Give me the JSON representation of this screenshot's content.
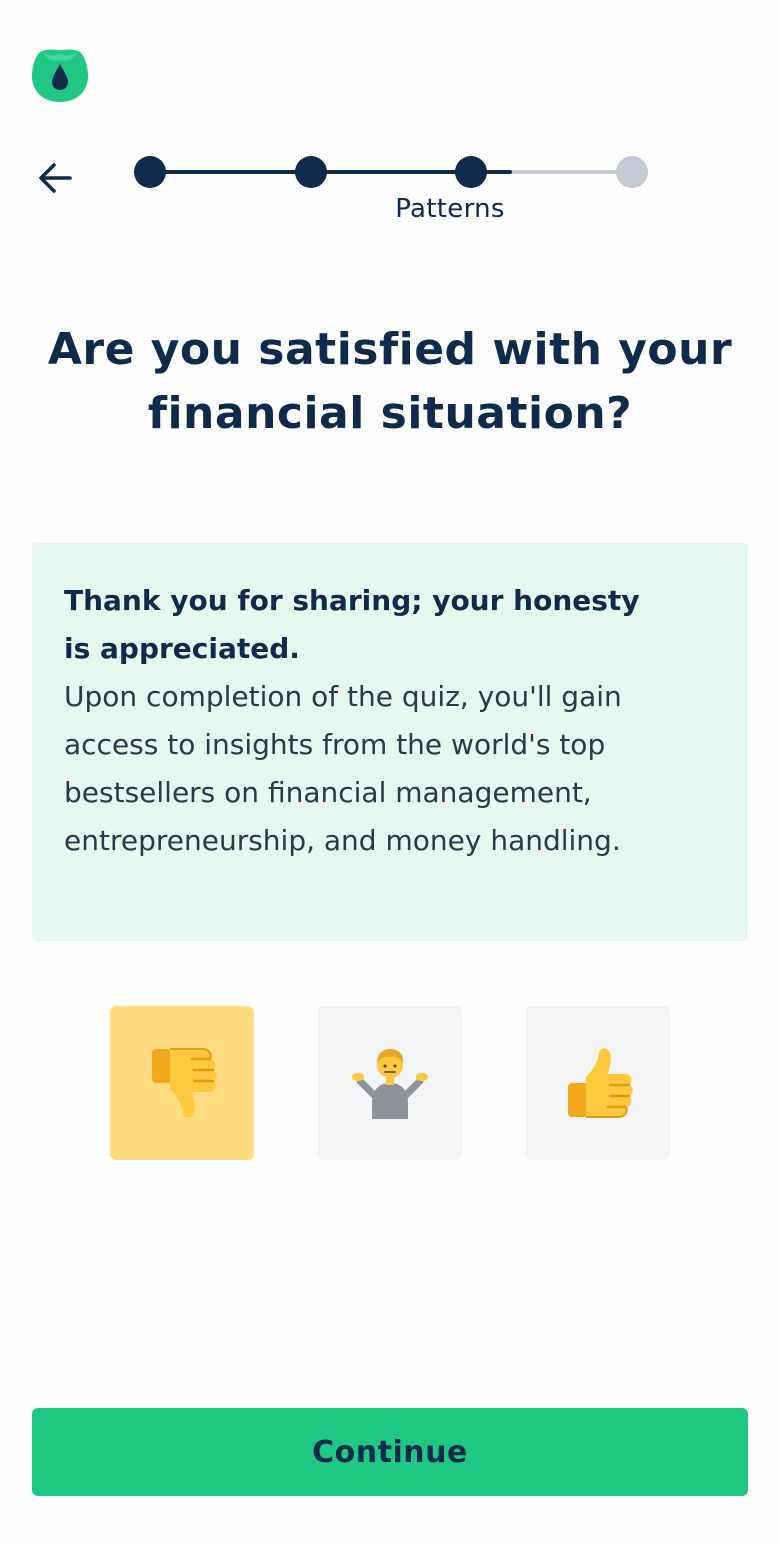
{
  "app": {
    "logo_icon": "droplet-leaf-logo-icon",
    "brand_color": "#1fc882"
  },
  "header": {
    "back_icon": "arrow-left-icon"
  },
  "progress": {
    "step_label": "Patterns",
    "total_steps": 4,
    "completed_steps": 3,
    "fill_fraction": 0.75,
    "active_color": "#0f2a4a",
    "inactive_color": "#c3cad3"
  },
  "question": {
    "title": "Are you satisfied with your financial situation?"
  },
  "feedback": {
    "heading": "Thank you for sharing; your honesty is appreciated.",
    "body": "Upon completion of the quiz, you'll gain access to insights from the world's top bestsellers on financial management, entrepreneurship, and money handling.",
    "background_color": "#e6f8ef"
  },
  "answers": [
    {
      "icon": "thumbs-down-icon",
      "selected": true
    },
    {
      "icon": "person-shrugging-icon",
      "selected": false
    },
    {
      "icon": "thumbs-up-icon",
      "selected": false
    }
  ],
  "footer": {
    "continue_label": "Continue"
  }
}
